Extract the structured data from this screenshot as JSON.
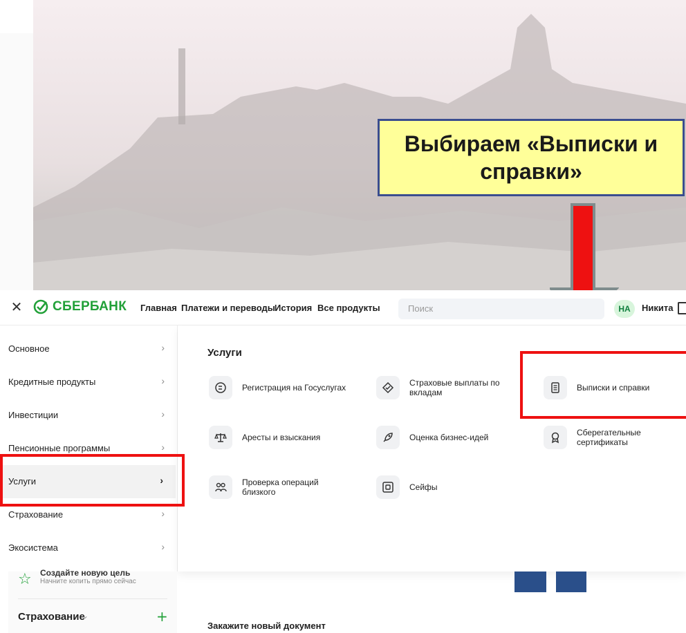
{
  "callout": {
    "text": "Выбираем «Выписки и справки»"
  },
  "header": {
    "close_icon": "close-icon",
    "brand": "СБЕРБАНК",
    "nav": [
      "Главная",
      "Платежи и переводы",
      "История",
      "Все продукты"
    ],
    "search_placeholder": "Поиск",
    "avatar_initials": "НА",
    "user_name": "Никита"
  },
  "menu": {
    "items": [
      {
        "label": "Основное"
      },
      {
        "label": "Кредитные продукты"
      },
      {
        "label": "Инвестиции"
      },
      {
        "label": "Пенсионные программы"
      },
      {
        "label": "Услуги",
        "active": true
      },
      {
        "label": "Страхование"
      },
      {
        "label": "Экосистема"
      }
    ]
  },
  "services": {
    "title": "Услуги",
    "items": [
      {
        "label": "Регистрация на Госуслугах",
        "icon": "gosuslugi-icon"
      },
      {
        "label": "Страховые выплаты по вкладам",
        "icon": "insurance-payout-icon"
      },
      {
        "label": "Выписки и справки",
        "icon": "document-icon"
      },
      {
        "label": "Аресты и взыскания",
        "icon": "scales-icon"
      },
      {
        "label": "Оценка бизнес-идей",
        "icon": "rocket-icon"
      },
      {
        "label": "Сберегательные сертификаты",
        "icon": "certificate-icon"
      },
      {
        "label": "Проверка операций близкого",
        "icon": "people-icon"
      },
      {
        "label": "Сейфы",
        "icon": "safe-icon"
      }
    ]
  },
  "lower": {
    "goal_title": "Создайте новую цель",
    "goal_subtitle": "Начните копить прямо сейчас",
    "insurance_title": "Страхование",
    "order_document": "Закажите новый документ"
  },
  "colors": {
    "brand_green": "#21a038",
    "highlight_red": "#ee1111",
    "callout_yellow": "#ffff99"
  }
}
